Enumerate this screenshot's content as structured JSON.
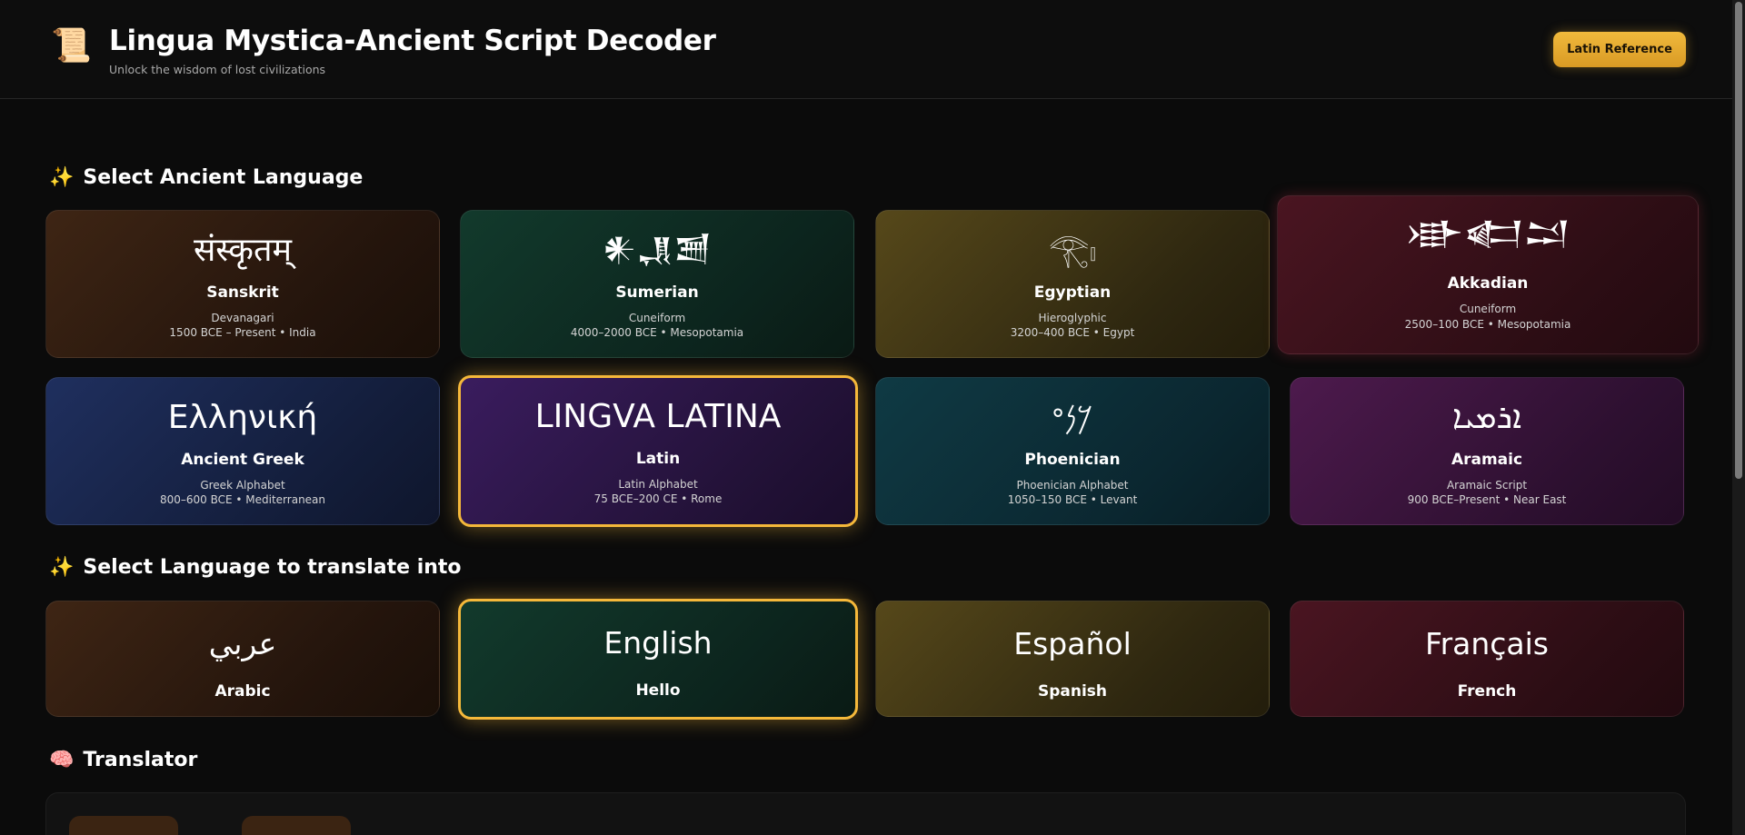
{
  "header": {
    "title": "Lingua Mystica-Ancient Script Decoder",
    "subtitle": "Unlock the wisdom of lost civilizations",
    "logo_icon": "scroll-icon",
    "reference_button": "Latin Reference"
  },
  "sections": {
    "source_title": "Select Ancient Language",
    "target_title": "Select Language to translate into",
    "translator_title": "Translator"
  },
  "ancient_languages": [
    {
      "script": "संस्कृतम्",
      "name": "Sanskrit",
      "system": "Devanagari",
      "era": "1500 BCE – Present • India",
      "color": "#3e2514",
      "selected": false
    },
    {
      "script": "𒀭𒂗𒍪",
      "name": "Sumerian",
      "system": "Cuneiform",
      "era": "4000–2000 BCE • Mesopotamia",
      "color": "#123a2c",
      "selected": false
    },
    {
      "script": "𓂀𓏤",
      "name": "Egyptian",
      "system": "Hieroglyphic",
      "era": "3200–400 BCE • Egypt",
      "color": "#56481a",
      "selected": false
    },
    {
      "script": "𒀝𒅗𒁺",
      "name": "Akkadian",
      "system": "Cuneiform",
      "era": "2500–100 BCE • Mesopotamia",
      "color": "#4a1521",
      "selected": false
    },
    {
      "script": "Ελληνική",
      "name": "Ancient Greek",
      "system": "Greek Alphabet",
      "era": "800–600 BCE • Mediterranean",
      "color": "#1f2f5e",
      "selected": false
    },
    {
      "script": "LINGVA LATINA",
      "name": "Latin",
      "system": "Latin Alphabet",
      "era": "75 BCE–200 CE • Rome",
      "color": "#3a1c5e",
      "selected": true
    },
    {
      "script": "𐤊𐤍𐤏",
      "name": "Phoenician",
      "system": "Phoenician Alphabet",
      "era": "1050–150 BCE • Levant",
      "color": "#0f3a44",
      "selected": false
    },
    {
      "script": "ܐܪܡܝܐ",
      "name": "Aramaic",
      "system": "Aramaic Script",
      "era": "900 BCE–Present • Near East",
      "color": "#4d1a4d",
      "selected": false
    }
  ],
  "target_languages": [
    {
      "script": "عربي",
      "name": "Arabic",
      "selected": false
    },
    {
      "script": "English",
      "name": "Hello",
      "selected": true
    },
    {
      "script": "Español",
      "name": "Spanish",
      "selected": false
    },
    {
      "script": "Français",
      "name": "French",
      "selected": false
    }
  ],
  "colors": {
    "accent": "#f5b83a",
    "background": "#0b0b0b"
  }
}
